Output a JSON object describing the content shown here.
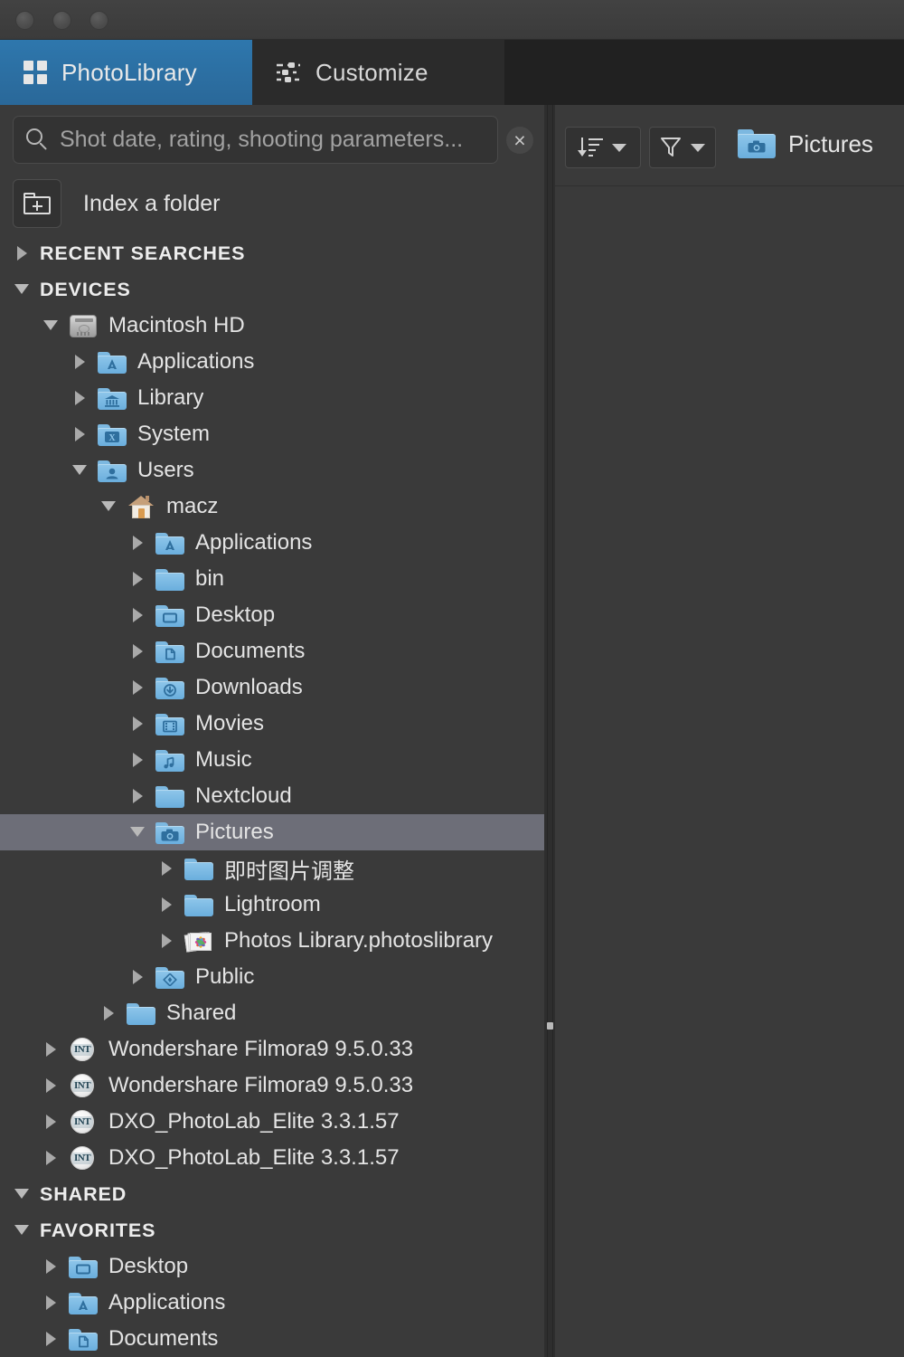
{
  "window": {
    "traffic_lights": [
      "close",
      "minimize",
      "zoom"
    ]
  },
  "tabs": [
    {
      "label": "PhotoLibrary",
      "icon": "grid-icon",
      "active": true
    },
    {
      "label": "Customize",
      "icon": "sliders-icon",
      "active": false
    }
  ],
  "search": {
    "placeholder": "Shot date, rating, shooting parameters...",
    "value": "",
    "icon": "search-icon",
    "clear_label": "×"
  },
  "index_folder": {
    "label": "Index a folder",
    "icon": "folder-plus-icon"
  },
  "toolbar": {
    "sort_label": "Sort",
    "filter_label": "Filter",
    "current_folder": "Pictures",
    "current_folder_icon": "camera-folder-icon"
  },
  "colors": {
    "accent_tab": "#2e77ad",
    "sidebar_bg": "#3a3a3a",
    "tabstrip_bg": "#212121",
    "selection": "#6d6e78",
    "folder_blue": "#8ec6ea",
    "text": "#e4e4e4"
  },
  "tree": [
    {
      "label": "RECENT SEARCHES",
      "depth": 0,
      "type": "section",
      "twisty": "right",
      "icon": "none"
    },
    {
      "label": "DEVICES",
      "depth": 0,
      "type": "section",
      "twisty": "down",
      "icon": "none"
    },
    {
      "label": "Macintosh HD",
      "depth": 1,
      "type": "item",
      "twisty": "down",
      "icon": "hard-disk-icon"
    },
    {
      "label": "Applications",
      "depth": 2,
      "type": "item",
      "twisty": "right",
      "icon": "applications-folder-icon"
    },
    {
      "label": "Library",
      "depth": 2,
      "type": "item",
      "twisty": "right",
      "icon": "library-folder-icon"
    },
    {
      "label": "System",
      "depth": 2,
      "type": "item",
      "twisty": "right",
      "icon": "system-folder-icon"
    },
    {
      "label": "Users",
      "depth": 2,
      "type": "item",
      "twisty": "down",
      "icon": "users-folder-icon"
    },
    {
      "label": "macz",
      "depth": 3,
      "type": "item",
      "twisty": "down",
      "icon": "home-icon"
    },
    {
      "label": "Applications",
      "depth": 4,
      "type": "item",
      "twisty": "right",
      "icon": "applications-folder-icon"
    },
    {
      "label": "bin",
      "depth": 4,
      "type": "item",
      "twisty": "right",
      "icon": "plain-folder-icon"
    },
    {
      "label": "Desktop",
      "depth": 4,
      "type": "item",
      "twisty": "right",
      "icon": "desktop-folder-icon"
    },
    {
      "label": "Documents",
      "depth": 4,
      "type": "item",
      "twisty": "right",
      "icon": "documents-folder-icon"
    },
    {
      "label": "Downloads",
      "depth": 4,
      "type": "item",
      "twisty": "right",
      "icon": "downloads-folder-icon"
    },
    {
      "label": "Movies",
      "depth": 4,
      "type": "item",
      "twisty": "right",
      "icon": "movies-folder-icon"
    },
    {
      "label": "Music",
      "depth": 4,
      "type": "item",
      "twisty": "right",
      "icon": "music-folder-icon"
    },
    {
      "label": "Nextcloud",
      "depth": 4,
      "type": "item",
      "twisty": "right",
      "icon": "plain-folder-icon"
    },
    {
      "label": "Pictures",
      "depth": 4,
      "type": "item",
      "twisty": "down",
      "icon": "camera-folder-icon",
      "selected": true
    },
    {
      "label": "即时图片调整",
      "depth": 5,
      "type": "item",
      "twisty": "right",
      "icon": "plain-folder-icon"
    },
    {
      "label": "Lightroom",
      "depth": 5,
      "type": "item",
      "twisty": "right",
      "icon": "plain-folder-icon"
    },
    {
      "label": "Photos Library.photoslibrary",
      "depth": 5,
      "type": "item",
      "twisty": "right",
      "icon": "photos-library-icon"
    },
    {
      "label": "Public",
      "depth": 4,
      "type": "item",
      "twisty": "right",
      "icon": "public-folder-icon"
    },
    {
      "label": "Shared",
      "depth": 3,
      "type": "item",
      "twisty": "right",
      "icon": "plain-folder-icon"
    },
    {
      "label": "Wondershare Filmora9 9.5.0.33",
      "depth": 1,
      "type": "item",
      "twisty": "right",
      "icon": "disk-image-icon"
    },
    {
      "label": "Wondershare Filmora9 9.5.0.33",
      "depth": 1,
      "type": "item",
      "twisty": "right",
      "icon": "disk-image-icon"
    },
    {
      "label": "DXO_PhotoLab_Elite 3.3.1.57",
      "depth": 1,
      "type": "item",
      "twisty": "right",
      "icon": "disk-image-icon"
    },
    {
      "label": "DXO_PhotoLab_Elite 3.3.1.57",
      "depth": 1,
      "type": "item",
      "twisty": "right",
      "icon": "disk-image-icon"
    },
    {
      "label": "SHARED",
      "depth": 0,
      "type": "section",
      "twisty": "down",
      "icon": "none"
    },
    {
      "label": "FAVORITES",
      "depth": 0,
      "type": "section",
      "twisty": "down",
      "icon": "none"
    },
    {
      "label": "Desktop",
      "depth": 1,
      "type": "item",
      "twisty": "right",
      "icon": "desktop-folder-icon"
    },
    {
      "label": "Applications",
      "depth": 1,
      "type": "item",
      "twisty": "right",
      "icon": "applications-folder-icon"
    },
    {
      "label": "Documents",
      "depth": 1,
      "type": "item",
      "twisty": "right",
      "icon": "documents-folder-icon"
    }
  ]
}
